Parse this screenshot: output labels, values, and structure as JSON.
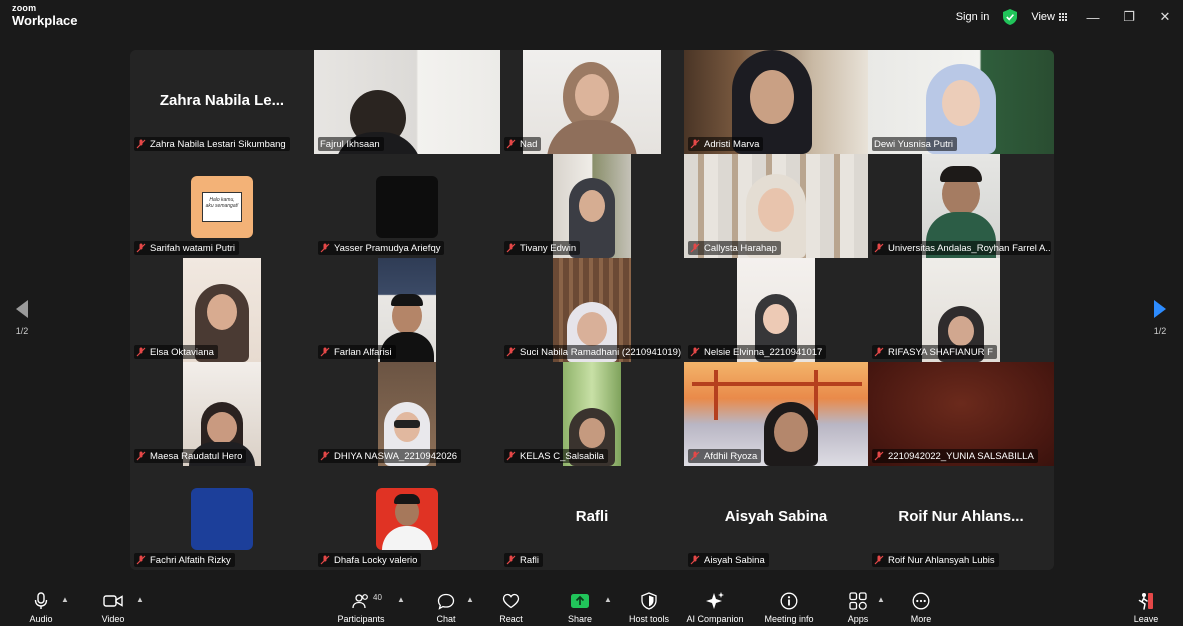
{
  "app": {
    "logo_top": "zoom",
    "logo_bottom": "Workplace",
    "sign_in": "Sign in",
    "view_label": "View",
    "window_controls": [
      "minimize-icon",
      "restore-icon",
      "close-icon"
    ]
  },
  "colors": {
    "active_speaker": "#2bd16e",
    "nav_left": "#9a9a9a",
    "nav_right": "#2d8cff",
    "share_green": "#21c45a",
    "leave_red": "#e54848",
    "mic_muted": "#e54848"
  },
  "pager": {
    "left_page": "1/2",
    "right_page": "1/2"
  },
  "participants": [
    {
      "name": "Zahra Nabila Lestari Sikumbang",
      "display_name": "Zahra Nabila Le...",
      "video": false
    },
    {
      "name": "Fajrul Ikhsaan",
      "video": true,
      "active": true
    },
    {
      "name": "Nad",
      "video": true
    },
    {
      "name": "Adristi Marva",
      "video": true
    },
    {
      "name": "Dewi Yusnisa Putri",
      "video": true
    },
    {
      "name": "Sarifah watami Putri",
      "video": false,
      "avatar_text": "Halo kamu, aku semangat!"
    },
    {
      "name": "Yasser Pramudya Ariefqy",
      "video": false
    },
    {
      "name": "Tivany Edwin",
      "video": true
    },
    {
      "name": "Callysta Harahap",
      "video": true
    },
    {
      "name": "Universitas Andalas_Royhan Farrel A...",
      "video": true
    },
    {
      "name": "Elsa Oktaviana",
      "video": true
    },
    {
      "name": "Farlan Alfarisi",
      "video": true
    },
    {
      "name": "Suci Nabila Ramadhani (2210941019)",
      "video": true
    },
    {
      "name": "Nelsie Elvinna_2210941017",
      "video": true
    },
    {
      "name": "RIFASYA SHAFIANUR F",
      "video": true
    },
    {
      "name": "Maesa Raudatul Hero",
      "video": true
    },
    {
      "name": "DHIYA NASWA_2210942026",
      "video": true
    },
    {
      "name": "KELAS C_Salsabila",
      "video": true
    },
    {
      "name": "Afdhil Ryoza",
      "video": true
    },
    {
      "name": "2210942022_YUNIA SALSABILLA",
      "video": true
    },
    {
      "name": "Fachri Alfatih Rizky",
      "video": false
    },
    {
      "name": "Dhafa Locky valerio",
      "video": false
    },
    {
      "name": "Rafli",
      "display_name": "Rafli",
      "video": false
    },
    {
      "name": "Aisyah Sabina",
      "display_name": "Aisyah Sabina",
      "video": false
    },
    {
      "name": "Roif Nur Ahlansyah Lubis",
      "display_name": "Roif Nur Ahlans...",
      "video": false
    }
  ],
  "toolbar": {
    "audio": "Audio",
    "video": "Video",
    "participants": "Participants",
    "participants_count": "40",
    "chat": "Chat",
    "react": "React",
    "share": "Share",
    "host_tools": "Host tools",
    "ai_companion": "AI Companion",
    "meeting_info": "Meeting info",
    "apps": "Apps",
    "more": "More",
    "leave": "Leave"
  }
}
